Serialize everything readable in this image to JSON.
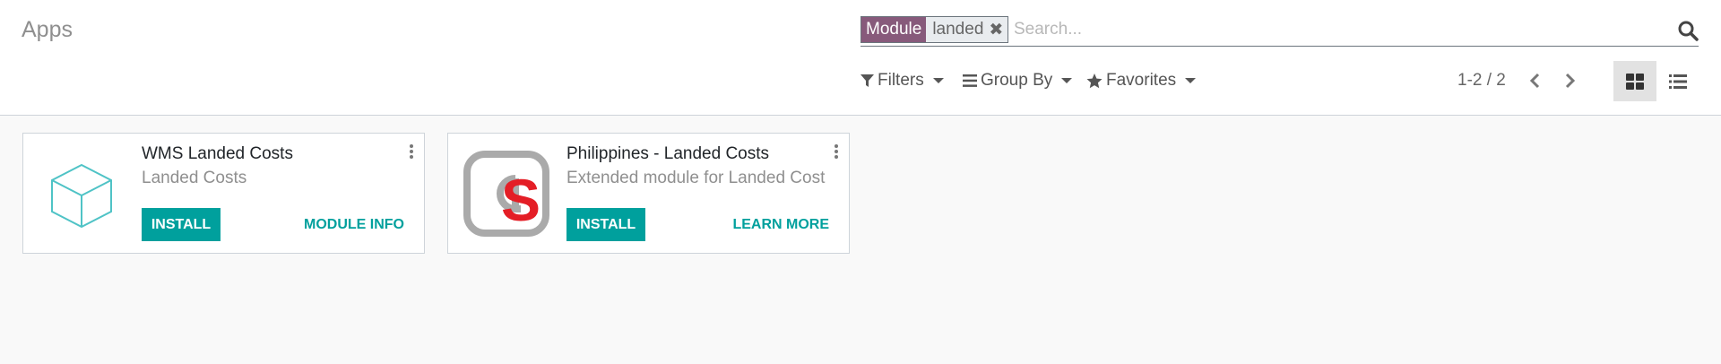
{
  "breadcrumb": {
    "title": "Apps"
  },
  "search": {
    "facet_category": "Module",
    "facet_value": "landed",
    "facet_remove_glyph": "✖",
    "placeholder": "Search..."
  },
  "toolbar": {
    "filters_label": "Filters",
    "groupby_label": "Group By",
    "favorites_label": "Favorites"
  },
  "pager": {
    "value": "1-2 / 2"
  },
  "views": {
    "active": "kanban"
  },
  "colors": {
    "primary": "#00a09d",
    "facet": "#875a7b",
    "logo_red": "#e41e26"
  },
  "cards": [
    {
      "title": "WMS Landed Costs",
      "summary": "Landed Costs",
      "install_label": "INSTALL",
      "link_label": "MODULE INFO",
      "icon": "cube-icon"
    },
    {
      "title": "Philippines - Landed Costs",
      "summary": "Extended module for Landed Cost",
      "install_label": "INSTALL",
      "link_label": "LEARN MORE",
      "icon": "as-logo-icon"
    }
  ]
}
